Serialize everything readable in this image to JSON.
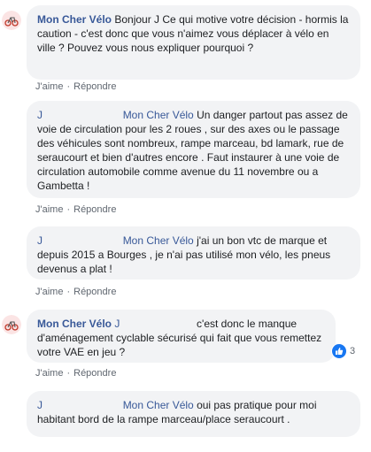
{
  "comments": [
    {
      "author": "Mon Cher Vélo",
      "text": "Bonjour J                       Ce qui motive votre décision - hormis la caution - c'est donc que vous n'aimez vous déplacer à vélo en ville ? Pouvez vous nous expliquer pourquoi ?",
      "actions": {
        "like": "J'aime",
        "reply": "Répondre"
      }
    },
    {
      "mention": "J",
      "author": "Mon Cher Vélo",
      "text": "Un danger partout pas assez de voie de circulation pour les 2 roues , sur des axes ou le passage des véhicules sont nombreux, rampe marceau, bd lamark, rue de seraucourt et bien d'autres encore . Faut instaurer à une voie de circulation automobile comme avenue du 11 novembre ou a Gambetta !",
      "actions": {
        "like": "J'aime",
        "reply": "Répondre"
      }
    },
    {
      "mention": "J",
      "author": "Mon Cher Vélo",
      "text": "j'ai un bon vtc de marque et depuis 2015 a Bourges , je n'ai pas utilisé mon vélo, les pneus devenus a plat !",
      "actions": {
        "like": "J'aime",
        "reply": "Répondre"
      }
    },
    {
      "author": "Mon Cher Vélo",
      "mention": "J",
      "text": "c'est donc le manque d'aménagement cyclable sécurisé qui fait que vous remettez votre VAE en jeu ?",
      "actions": {
        "like": "J'aime",
        "reply": "Répondre"
      },
      "reaction": {
        "icon": "like-icon",
        "count": "3"
      }
    },
    {
      "mention": "J",
      "author": "Mon Cher Vélo",
      "text": "oui pas pratique pour moi habitant bord de la rampe marceau/place seraucourt ."
    }
  ],
  "colors": {
    "bubble": "#f2f3f5",
    "link": "#385898",
    "meta": "#606770",
    "like": "#1877f2",
    "avatar_bg": "#fbe4e4"
  }
}
